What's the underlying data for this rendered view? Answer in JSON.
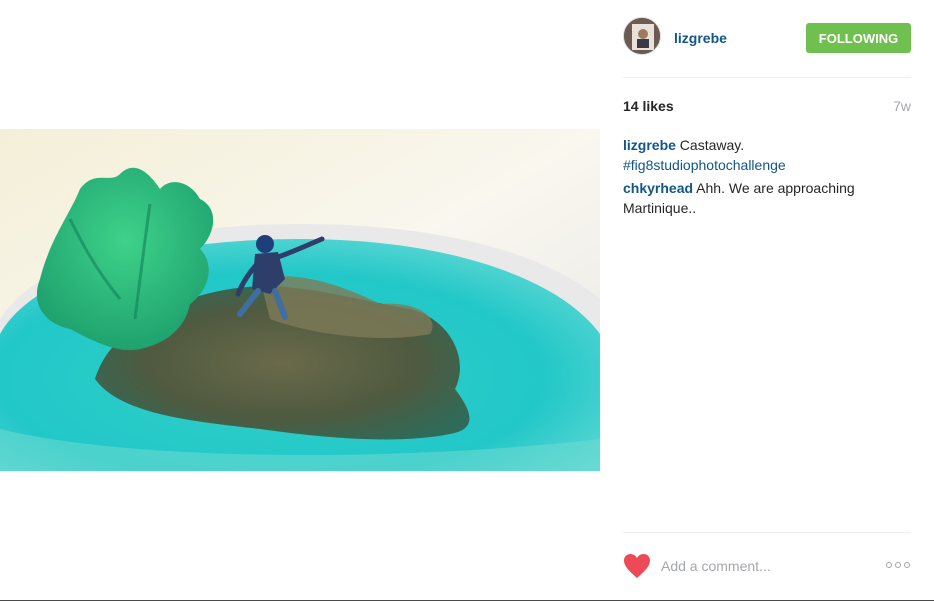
{
  "post": {
    "author": "lizgrebe",
    "follow_label": "FOLLOWING",
    "likes": "14 likes",
    "time_ago": "7w",
    "caption": {
      "user": "lizgrebe",
      "text": " Castaway.",
      "hashtag": "#fig8studiophotochallenge"
    },
    "comments": [
      {
        "user": "chkyrhead",
        "text": " Ahh. We are approaching Martinique.."
      }
    ],
    "add_comment_placeholder": "Add a comment..."
  },
  "colors": {
    "link": "#125688",
    "follow_button": "#70c050",
    "heart": "#ed4956",
    "muted": "#a5a7aa"
  },
  "icons": {
    "like": "heart-icon",
    "more": "more-options-icon"
  }
}
